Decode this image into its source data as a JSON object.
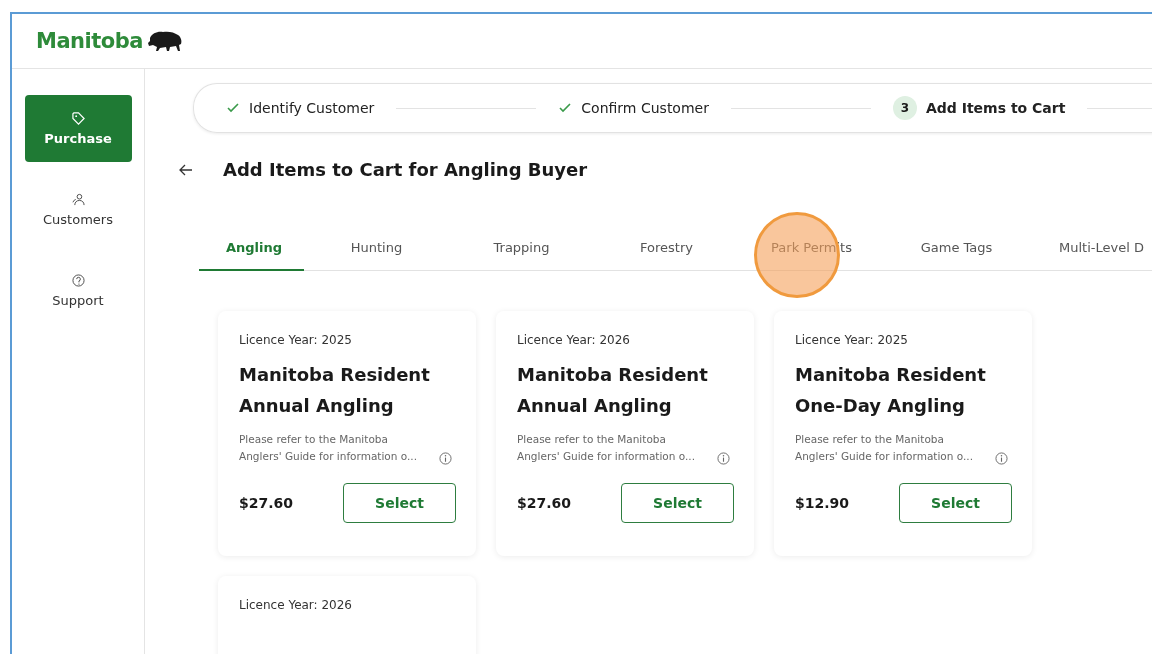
{
  "header": {
    "logo": "Manitoba"
  },
  "sidebar": {
    "items": [
      {
        "label": "Purchase",
        "kind": "tag",
        "selected": true
      },
      {
        "label": "Customers",
        "kind": "users",
        "selected": false
      },
      {
        "label": "Support",
        "kind": "help",
        "selected": false
      }
    ]
  },
  "stepper": {
    "steps": [
      {
        "label": "Identify Customer",
        "kind": "done"
      },
      {
        "label": "Confirm Customer",
        "kind": "done"
      },
      {
        "label": "Add Items to Cart",
        "kind": "current",
        "number": "3"
      }
    ]
  },
  "title": "Add Items to Cart for Angling Buyer",
  "tabs": [
    {
      "label": "Angling",
      "selected": true
    },
    {
      "label": "Hunting",
      "selected": false
    },
    {
      "label": "Trapping",
      "selected": false
    },
    {
      "label": "Forestry",
      "selected": false
    },
    {
      "label": "Park Permits",
      "selected": false
    },
    {
      "label": "Game Tags",
      "selected": false
    },
    {
      "label": "Multi-Level D",
      "selected": false
    }
  ],
  "cards": [
    {
      "year": "Licence Year: 2025",
      "name": "Manitoba Resident Annual Angling",
      "description": "Please refer to the Manitoba Anglers' Guide for information o...",
      "price": "$27.60",
      "button": "Select"
    },
    {
      "year": "Licence Year: 2026",
      "name": "Manitoba Resident Annual Angling",
      "description": "Please refer to the Manitoba Anglers' Guide for information o...",
      "price": "$27.60",
      "button": "Select"
    },
    {
      "year": "Licence Year: 2025",
      "name": "Manitoba Resident One-Day Angling",
      "description": "Please refer to the Manitoba Anglers' Guide for information o...",
      "price": "$12.90",
      "button": "Select"
    },
    {
      "year": "Licence Year: 2026"
    }
  ]
}
